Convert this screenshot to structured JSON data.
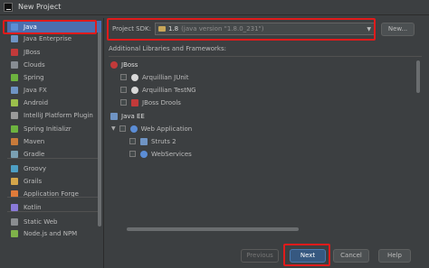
{
  "window": {
    "title": "New Project"
  },
  "sidebar": {
    "items": [
      {
        "label": "Java",
        "icon": "folder-icon",
        "color": "#5b8dd6",
        "selected": true
      },
      {
        "label": "Java Enterprise",
        "icon": "java-enterprise-icon",
        "color": "#6f94c4"
      },
      {
        "label": "JBoss",
        "icon": "jboss-icon",
        "color": "#c23a3a"
      },
      {
        "label": "Clouds",
        "icon": "cloud-icon",
        "color": "#888d93"
      },
      {
        "label": "Spring",
        "icon": "spring-icon",
        "color": "#6db33f"
      },
      {
        "label": "Java FX",
        "icon": "javafx-icon",
        "color": "#6f94c4"
      },
      {
        "label": "Android",
        "icon": "android-icon",
        "color": "#9bbf4c"
      },
      {
        "label": "IntelliJ Platform Plugin",
        "icon": "plugin-icon",
        "color": "#9a9a9a"
      },
      {
        "label": "Spring Initializr",
        "icon": "spring-initializr-icon",
        "color": "#6db33f"
      },
      {
        "label": "Maven",
        "icon": "maven-icon",
        "color": "#c87a3a"
      },
      {
        "label": "Gradle",
        "icon": "gradle-icon",
        "color": "#7aa0b3"
      },
      {
        "label": "Groovy",
        "icon": "groovy-icon",
        "color": "#4d9fc4"
      },
      {
        "label": "Grails",
        "icon": "grails-icon",
        "color": "#d4a64a"
      },
      {
        "label": "Application Forge",
        "icon": "application-forge-icon",
        "color": "#e07b3a"
      },
      {
        "label": "Kotlin",
        "icon": "kotlin-icon",
        "color": "#8a7ad8"
      },
      {
        "label": "Static Web",
        "icon": "static-web-icon",
        "color": "#8a8d90"
      },
      {
        "label": "Node.js and NPM",
        "icon": "nodejs-icon",
        "color": "#7fb24a"
      }
    ]
  },
  "sdk": {
    "label": "Project SDK:",
    "value": "1.8",
    "hint": "(java version \"1.8.0_231\")",
    "new_button": "New..."
  },
  "libraries": {
    "label": "Additional Libraries and Frameworks:",
    "groups": [
      {
        "name": "JBoss",
        "items": [
          "Arquillian JUnit",
          "Arquillian TestNG",
          "JBoss Drools"
        ]
      },
      {
        "name": "Java EE",
        "items": [
          "Web Application",
          "Struts 2",
          "WebServices"
        ]
      }
    ]
  },
  "buttons": {
    "previous": "Previous",
    "next": "Next",
    "cancel": "Cancel",
    "help": "Help"
  },
  "colors": {
    "highlight": "#e01b1b",
    "selection": "#4b6eaf",
    "primary_button": "#365880"
  }
}
